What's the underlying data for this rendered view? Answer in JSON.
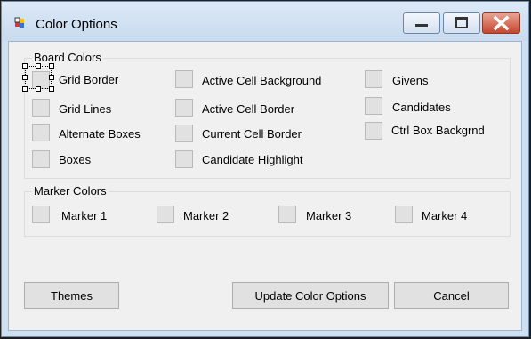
{
  "window": {
    "title": "Color Options"
  },
  "title_buttons": {
    "minimize": "minimize-icon",
    "maximize": "maximize-icon",
    "close": "close-icon"
  },
  "board_colors": {
    "title": "Board Colors",
    "items": [
      "Grid Border",
      "Grid Lines",
      "Alternate Boxes",
      "Boxes",
      "Active Cell Background",
      "Active Cell Border",
      "Current Cell Border",
      "Candidate Highlight",
      "Givens",
      "Candidates",
      "Ctrl Box Backgrnd"
    ]
  },
  "marker_colors": {
    "title": "Marker Colors",
    "items": [
      "Marker 1",
      "Marker 2",
      "Marker 3",
      "Marker 4"
    ]
  },
  "buttons": {
    "themes": "Themes",
    "update": "Update Color Options",
    "cancel": "Cancel"
  },
  "colors": {
    "swatch": "#e1e1e1",
    "close_button": "#c7452f",
    "title_bar": "#cfe0f3"
  }
}
